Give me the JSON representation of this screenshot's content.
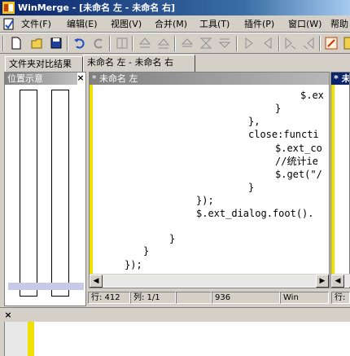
{
  "window": {
    "title": "WinMerge - [未命名 左 - 未命名 右]"
  },
  "menu": [
    "文件(F)",
    "编辑(E)",
    "视图(V)",
    "合并(M)",
    "工具(T)",
    "插件(P)",
    "窗口(W)",
    "帮助"
  ],
  "toolbar_icons": [
    "new-icon",
    "open-icon",
    "save-icon",
    "undo-icon",
    "redo-icon",
    "options-icon",
    "prev-diff-icon",
    "next-diff-icon",
    "first-diff-icon",
    "current-diff-icon",
    "last-diff-icon",
    "copy-right-icon",
    "copy-left-icon",
    "copy-right-advance-icon",
    "copy-left-advance-icon",
    "all-right-icon",
    "all-left-icon",
    "edit-icon",
    "help-icon"
  ],
  "tabs": [
    "文件夹对比结果",
    "未命名 左 - 未命名 右"
  ],
  "location_pane": {
    "title": "位置示意"
  },
  "left_editor": {
    "title": "* 未命名 左",
    "lines": [
      "$.ex",
      "}",
      "},",
      "close:functi",
      "$.ext_co",
      "//统计ie",
      "$.get(\"/",
      "}",
      "});",
      "$.ext_dialog.foot().",
      "",
      "}",
      "}",
      "});",
      "--"
    ]
  },
  "right_editor": {
    "title": "* 未"
  },
  "status": {
    "line_label": "行: 412",
    "col_label": "列: 1/1",
    "chars": "936",
    "eol": "Win",
    "right_line": "行:"
  }
}
